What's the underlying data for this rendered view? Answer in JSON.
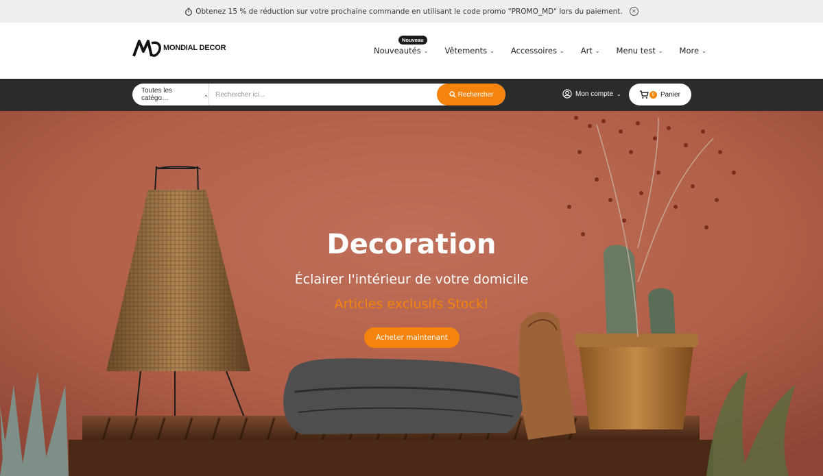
{
  "promo": {
    "text": "Obtenez 15 % de réduction sur votre prochaine commande en utilisant le code promo \"PROMO_MD\" lors du paiement.",
    "close_icon": "close-circle-icon"
  },
  "header": {
    "logo_text": "MONDIAL DECOR",
    "nav": [
      {
        "label": "Nouveautés",
        "badge": "Nouveau"
      },
      {
        "label": "Vêtements"
      },
      {
        "label": "Accessoires"
      },
      {
        "label": "Art"
      },
      {
        "label": "Menu test"
      },
      {
        "label": "More"
      }
    ]
  },
  "search": {
    "category": "Toutes les catégo…",
    "placeholder": "Rechercher ici...",
    "button": "Rechercher",
    "account": "Mon compte",
    "cart_count": "0",
    "cart_label": "Panier"
  },
  "hero": {
    "title": "Decoration",
    "subtitle": "Éclairer l'intérieur de votre domicile",
    "tagline": "Articles exclusifs Stock!",
    "cta": "Acheter maintenant"
  },
  "colors": {
    "accent": "#f5840c",
    "dark_band": "#2b2b2b",
    "hero_wall": "#b0604a"
  }
}
